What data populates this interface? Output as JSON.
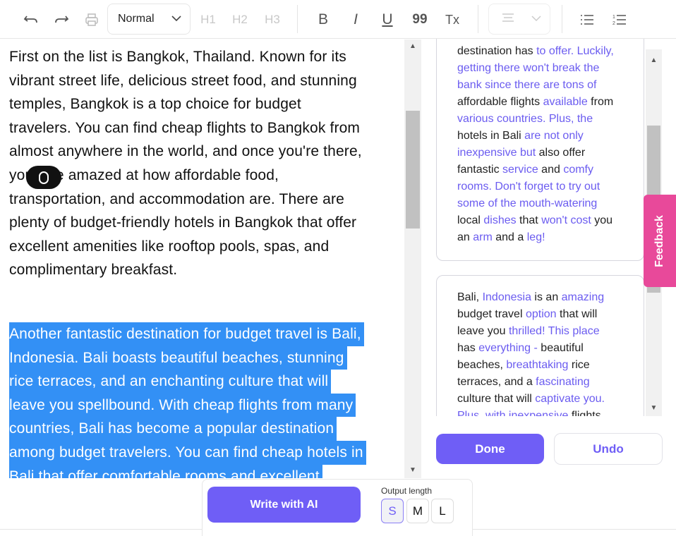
{
  "toolbar": {
    "icons": [
      "undo-icon",
      "redo-icon",
      "print-icon"
    ],
    "block_format": "Normal",
    "h1": "H1",
    "h2": "H2",
    "h3": "H3",
    "bold": "B",
    "italic": "I",
    "underline": "U",
    "quote": "99",
    "clear_format": "Tx"
  },
  "editor": {
    "paragraph1": [
      "First on the list is Bangkok, Thailand. Known for its",
      "vibrant street life, delicious street food, and stunning",
      "temples, Bangkok is a top choice for budget",
      "travelers. You can find cheap flights to Bangkok from",
      "almost anywhere in the world, and once you're there,",
      "you'll be amazed at how affordable food,",
      "transportation, and accommodation are. There are",
      "plenty of budget-friendly hotels in Bangkok that offer",
      "excellent amenities like rooftop pools, spas, and",
      "complimentary breakfast."
    ],
    "paragraph2_selected": [
      "Another fantastic destination for budget travel is Bali,",
      "Indonesia. Bali boasts beautiful beaches, stunning",
      "rice terraces, and an enchanting culture that will",
      "leave you spellbound. With cheap flights from many",
      "countries, Bali has become a popular destination",
      "among budget travelers. You can find cheap hotels in",
      "Bali that offer comfortable rooms and excellent"
    ]
  },
  "suggestions": {
    "card1": [
      [
        [
          "destination has ",
          0
        ],
        [
          "to offer. Luckily,",
          1
        ]
      ],
      [
        [
          "getting there won't break the",
          1
        ]
      ],
      [
        [
          "bank since there are tons of",
          1
        ]
      ],
      [
        [
          "affordable flights ",
          0
        ],
        [
          "available",
          1
        ],
        [
          " from",
          0
        ]
      ],
      [
        [
          "various countries. Plus, the",
          1
        ]
      ],
      [
        [
          "hotels in Bali ",
          0
        ],
        [
          "are not only",
          1
        ]
      ],
      [
        [
          "inexpensive but",
          1
        ],
        [
          " also offer",
          0
        ]
      ],
      [
        [
          "fantastic ",
          0
        ],
        [
          "service",
          1
        ],
        [
          " and ",
          0
        ],
        [
          "comfy",
          1
        ]
      ],
      [
        [
          "rooms. Don't forget to try out",
          1
        ]
      ],
      [
        [
          "some of the mouth-watering",
          1
        ]
      ],
      [
        [
          "local ",
          0
        ],
        [
          "dishes",
          1
        ],
        [
          " that ",
          0
        ],
        [
          "won't cost",
          1
        ],
        [
          " you",
          0
        ]
      ],
      [
        [
          "an ",
          0
        ],
        [
          "arm",
          1
        ],
        [
          " and a ",
          0
        ],
        [
          "leg!",
          1
        ]
      ]
    ],
    "card2": [
      [
        [
          "Bali, ",
          0
        ],
        [
          "Indonesia",
          1
        ],
        [
          " is an ",
          0
        ],
        [
          "amazing",
          1
        ]
      ],
      [
        [
          "budget travel ",
          0
        ],
        [
          "option",
          1
        ],
        [
          " that will",
          0
        ]
      ],
      [
        [
          "leave you ",
          0
        ],
        [
          "thrilled! This place",
          1
        ]
      ],
      [
        [
          "has ",
          0
        ],
        [
          "everything -",
          1
        ],
        [
          " beautiful",
          0
        ]
      ],
      [
        [
          "beaches, ",
          0
        ],
        [
          "breathtaking",
          1
        ],
        [
          " rice",
          0
        ]
      ],
      [
        [
          "terraces, and a ",
          0
        ],
        [
          "fascinating",
          1
        ]
      ],
      [
        [
          "culture that will ",
          0
        ],
        [
          "captivate you.",
          1
        ]
      ],
      [
        [
          "Plus, with inexpensive",
          1
        ],
        [
          " flights",
          0
        ]
      ]
    ],
    "done": "Done",
    "undo": "Undo"
  },
  "feedback": "Feedback",
  "footer": {
    "write_ai": "Write with AI",
    "output_length_label": "Output length",
    "lengths": [
      "S",
      "M",
      "L"
    ],
    "selected_length": "S"
  },
  "colors": {
    "accent": "#6f5ef6",
    "highlight_text": "#6b5cf0",
    "selection": "#3390f5",
    "feedback": "#e8499a"
  }
}
